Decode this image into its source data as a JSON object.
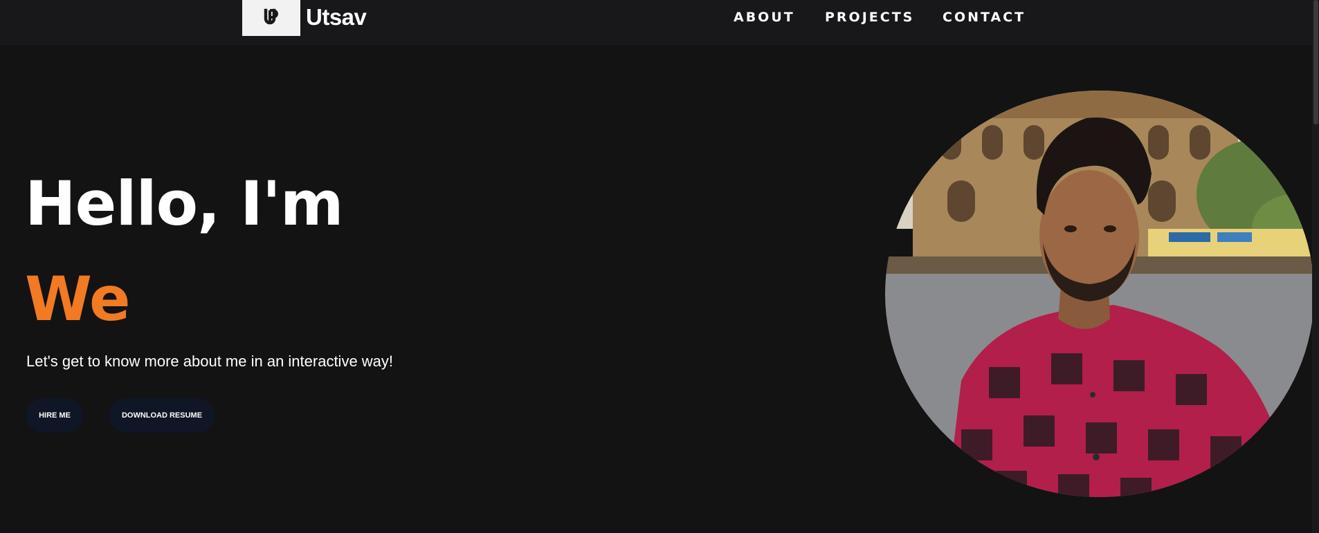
{
  "header": {
    "brand": "Utsav",
    "nav": [
      {
        "label": "ABOUT"
      },
      {
        "label": "PROJECTS"
      },
      {
        "label": "CONTACT"
      }
    ]
  },
  "hero": {
    "greeting": "Hello, I'm",
    "typed_text": "We",
    "subtitle": "Let's get to know more about me in an interactive way!",
    "buttons": {
      "hire": "HIRE ME",
      "resume": "DOWNLOAD RESUME"
    }
  },
  "colors": {
    "background": "#131314",
    "navbar": "#18181a",
    "accent": "#f17a22",
    "button": "#0f1626"
  },
  "icons": {
    "logo": "up-monogram-icon"
  }
}
